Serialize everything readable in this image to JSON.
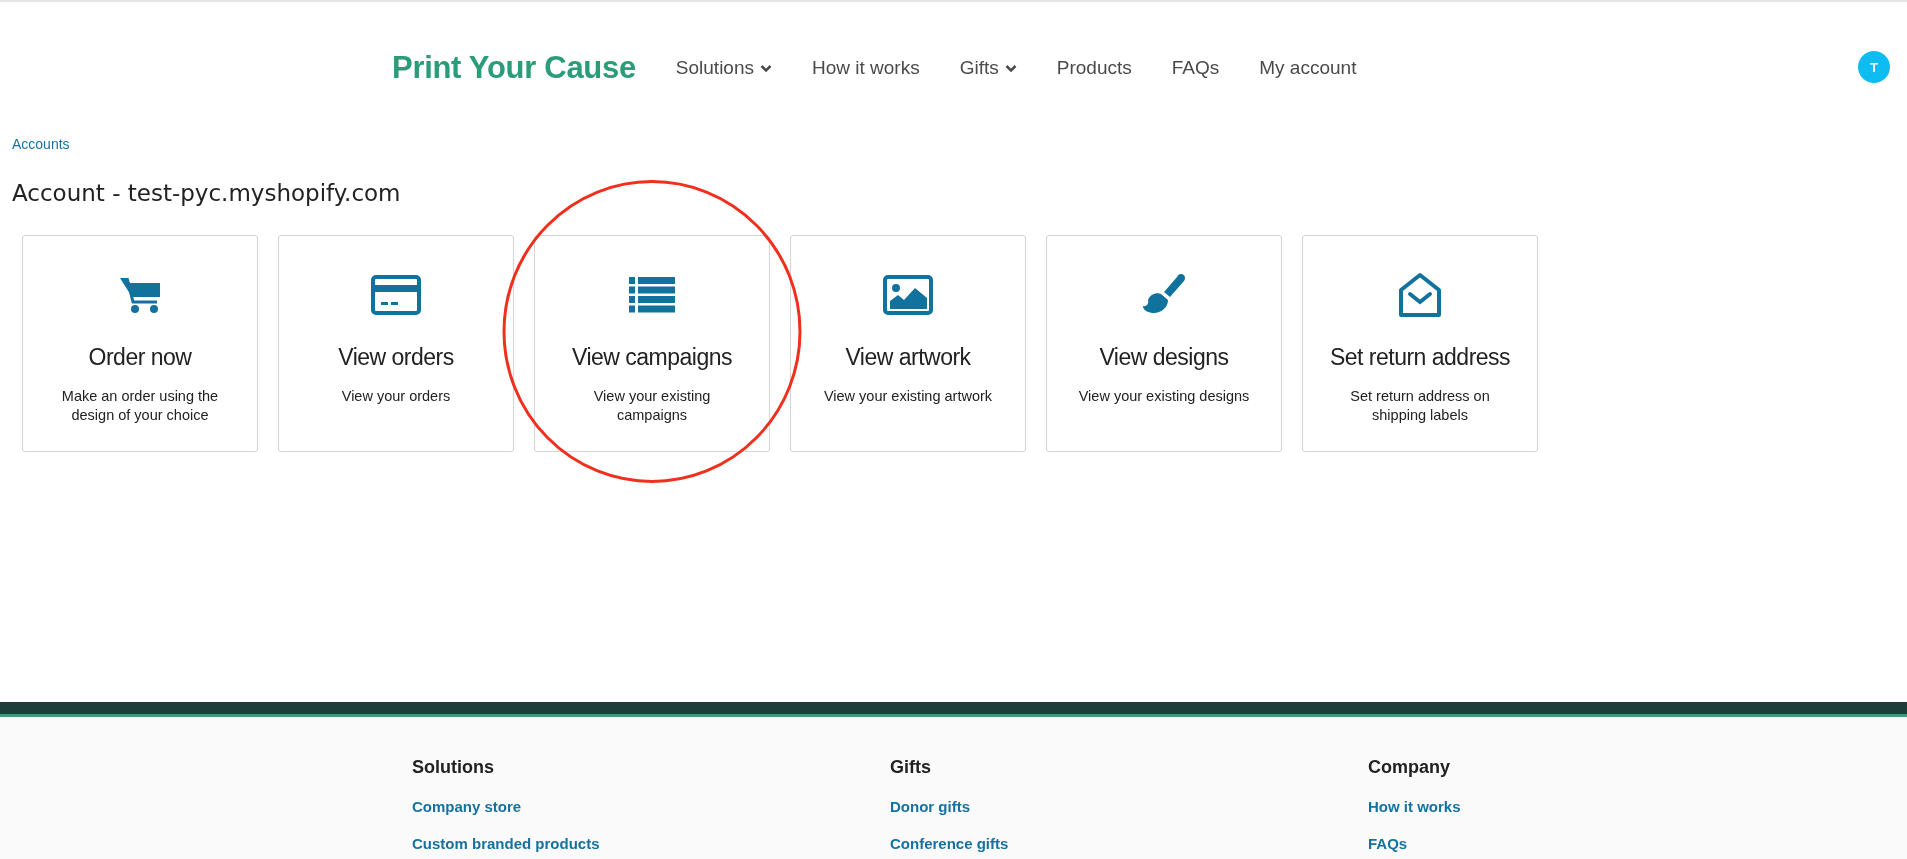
{
  "header": {
    "logo": "Print Your Cause",
    "nav": [
      {
        "label": "Solutions",
        "dropdown": true
      },
      {
        "label": "How it works",
        "dropdown": false
      },
      {
        "label": "Gifts",
        "dropdown": true
      },
      {
        "label": "Products",
        "dropdown": false
      },
      {
        "label": "FAQs",
        "dropdown": false
      },
      {
        "label": "My account",
        "dropdown": false
      }
    ],
    "avatar": "T"
  },
  "breadcrumb": "Accounts",
  "title": "Account - test-pyc.myshopify.com",
  "cards": [
    {
      "kind": "cart",
      "title": "Order now",
      "description": "Make an order using the design of your choice",
      "circled": false
    },
    {
      "kind": "card",
      "title": "View orders",
      "description": "View your orders",
      "circled": false
    },
    {
      "kind": "list",
      "title": "View campaigns",
      "description": "View your existing campaigns",
      "circled": true
    },
    {
      "kind": "image",
      "title": "View artwork",
      "description": "View your existing artwork",
      "circled": false
    },
    {
      "kind": "brush",
      "title": "View designs",
      "description": "View your existing designs",
      "circled": false
    },
    {
      "kind": "envelope",
      "title": "Set return address",
      "description": "Set return address on shipping labels",
      "circled": false
    }
  ],
  "footer": {
    "columns": [
      {
        "heading": "Solutions",
        "links": [
          "Company store",
          "Custom branded products"
        ]
      },
      {
        "heading": "Gifts",
        "links": [
          "Donor gifts",
          "Conference gifts"
        ]
      },
      {
        "heading": "Company",
        "links": [
          "How it works",
          "FAQs"
        ]
      }
    ]
  }
}
